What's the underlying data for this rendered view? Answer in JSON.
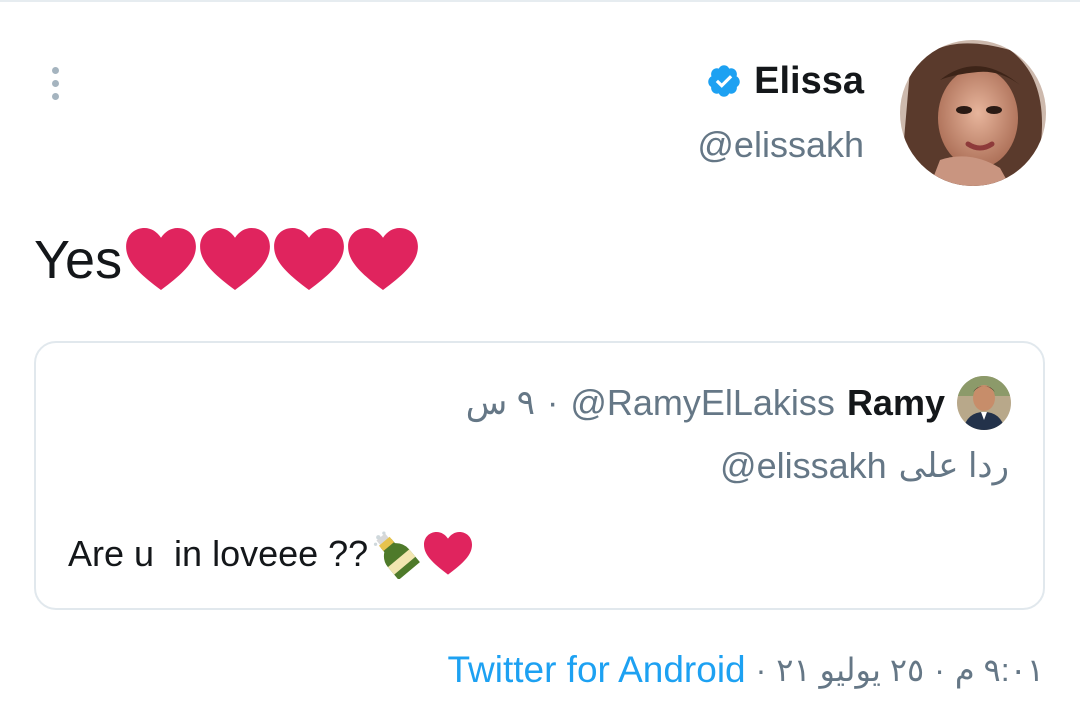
{
  "author": {
    "name": "Elissa",
    "handle": "@elissakh",
    "verified": true,
    "verified_color": "#1da1f2"
  },
  "tweet": {
    "text": "Yes",
    "emoji": [
      "red-heart-icon",
      "red-heart-icon",
      "red-heart-icon",
      "red-heart-icon"
    ],
    "heart_color": "#e0245e"
  },
  "quoted_tweet": {
    "name": "Ramy",
    "handle": "@RamyElLakiss",
    "separator": "·",
    "time": "٩ س",
    "reply_prefix": "ردا على",
    "reply_handle": "@elissakh",
    "text": "Are u  in loveee ??",
    "emoji": [
      "champagne-icon",
      "red-heart-icon"
    ]
  },
  "footer": {
    "time": "٩:٠١ م",
    "separator1": "·",
    "date": "٢٥ يوليو ٢١",
    "separator2": "·",
    "source": "Twitter for Android",
    "source_color": "#1da1f2"
  },
  "icons": {
    "more": "vertical-dots-icon"
  }
}
